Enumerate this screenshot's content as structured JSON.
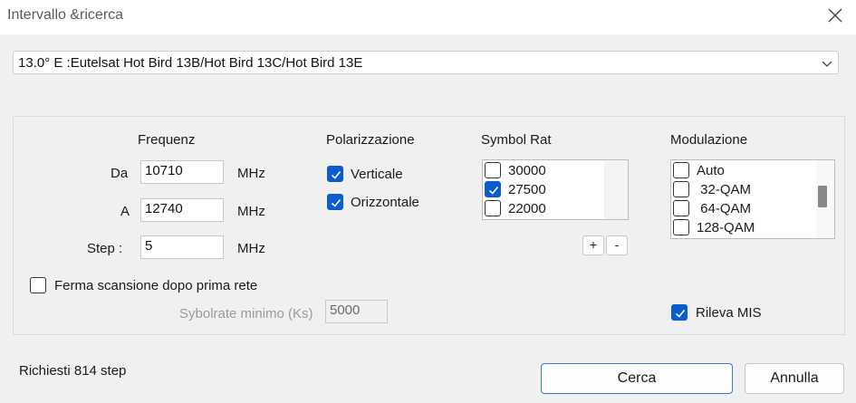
{
  "window": {
    "title": "Intervallo &ricerca"
  },
  "satellite": {
    "selected": "13.0° E :Eutelsat Hot Bird 13B/Hot Bird 13C/Hot Bird 13E"
  },
  "frequency": {
    "header": "Frequenz",
    "from_label": "Da",
    "from_value": "10710",
    "to_label": "A",
    "to_value": "12740",
    "step_label": "Step :",
    "step_value": "5",
    "unit": "MHz"
  },
  "polarization": {
    "header": "Polarizzazione",
    "items": [
      {
        "label": "Verticale",
        "checked": true
      },
      {
        "label": "Orizzontale",
        "checked": true
      }
    ]
  },
  "symbol_rate": {
    "header": "Symbol Rat",
    "items": [
      {
        "label": "30000",
        "checked": false
      },
      {
        "label": "27500",
        "checked": true
      },
      {
        "label": "22000",
        "checked": false
      }
    ],
    "add_label": "+",
    "remove_label": "-"
  },
  "modulation": {
    "header": "Modulazione",
    "items": [
      {
        "label": "Auto",
        "checked": false
      },
      {
        "label": " 32-QAM",
        "checked": false
      },
      {
        "label": " 64-QAM",
        "checked": false
      },
      {
        "label": "128-QAM",
        "checked": false
      }
    ]
  },
  "stop_after_first": {
    "label": "Ferma scansione dopo prima rete",
    "checked": false
  },
  "min_symbolrate": {
    "label": "Sybolrate minimo (Ks)",
    "value": "5000"
  },
  "detect_mis": {
    "label": "Rileva MIS",
    "checked": true
  },
  "status": {
    "text": "Richiesti 814 step"
  },
  "buttons": {
    "ok": "Cerca",
    "cancel": "Annulla"
  }
}
